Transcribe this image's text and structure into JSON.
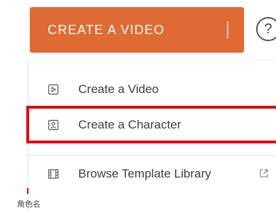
{
  "toolbar": {
    "create_label": "CREATE A VIDEO",
    "help_glyph": "?"
  },
  "menu": {
    "items": [
      {
        "label": "Create a Video",
        "icon": "video-play-icon"
      },
      {
        "label": "Create a Character",
        "icon": "character-portrait-icon"
      },
      {
        "label": "Browse Template Library",
        "icon": "film-strip-icon",
        "trailing_icon": "external-link-icon"
      }
    ]
  },
  "caption": {
    "text": "角色名"
  },
  "colors": {
    "brand_orange": "#e06a33",
    "highlight_red": "#e3000f",
    "menu_text": "#3e3e3e"
  }
}
